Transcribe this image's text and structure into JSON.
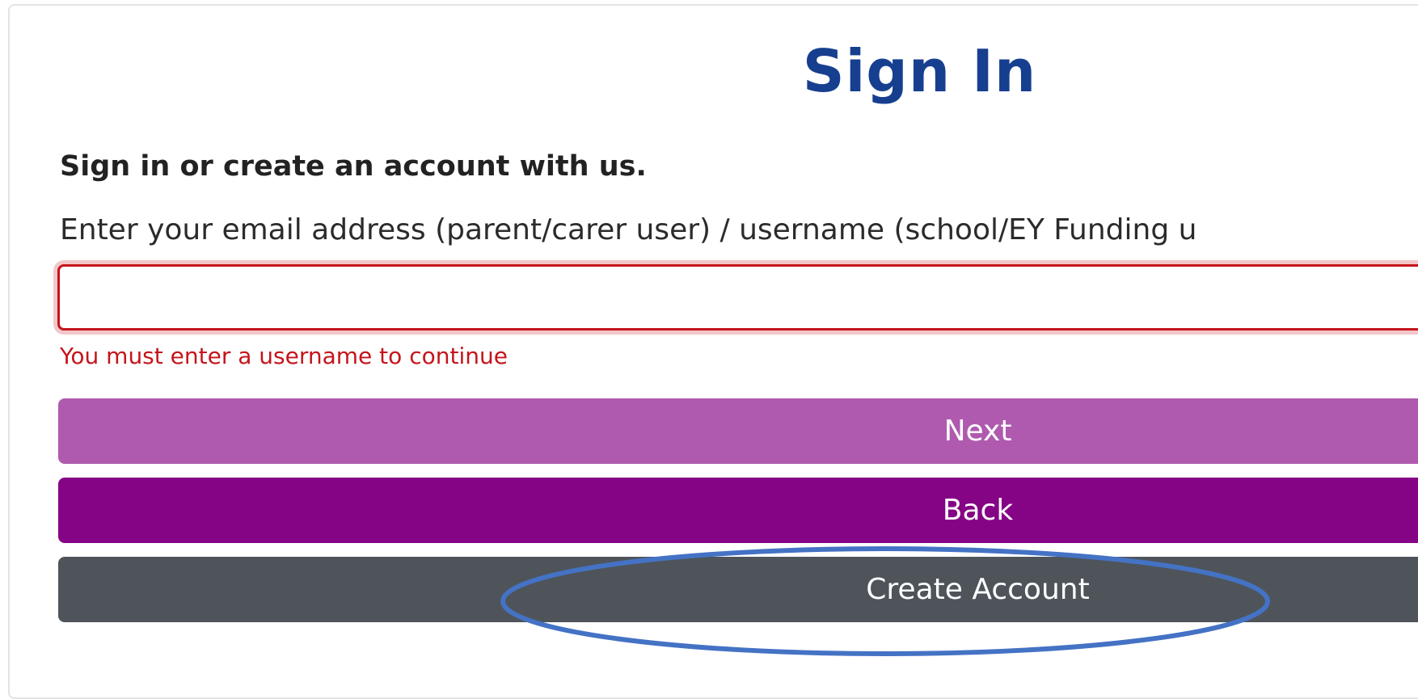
{
  "page": {
    "title": "Sign In",
    "subtitle": "Sign in or create an account with us.",
    "field_label": "Enter your email address (parent/carer user) / username (school/EY Funding u",
    "username_value": "",
    "error_message": "You must enter a username to continue"
  },
  "buttons": {
    "next_label": "Next",
    "back_label": "Back",
    "create_account_label": "Create Account"
  },
  "colors": {
    "title": "#173f8f",
    "error": "#c4151c",
    "next_button": "#af5aaf",
    "back_button": "#850485",
    "create_account_button": "#4e545a",
    "annotation_ellipse": "#4472c4"
  }
}
